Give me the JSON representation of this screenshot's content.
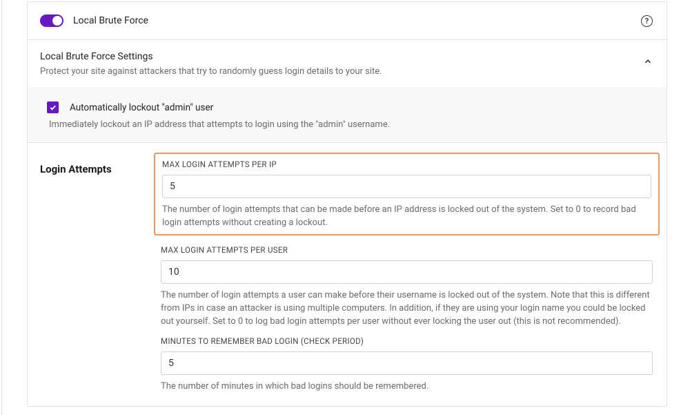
{
  "header": {
    "feature_title": "Local Brute Force",
    "help_char": "?"
  },
  "settings": {
    "title": "Local Brute Force Settings",
    "description": "Protect your site against attackers that try to randomly guess login details to your site."
  },
  "admin_lockout": {
    "label": "Automatically lockout \"admin\" user",
    "desc": "Immediately lockout an IP address that attempts to login using the \"admin\" username."
  },
  "login_attempts": {
    "section_title": "Login Attempts",
    "per_ip": {
      "label": "MAX LOGIN ATTEMPTS PER IP",
      "value": "5",
      "help": "The number of login attempts that can be made before an IP address is locked out of the system. Set to 0 to record bad login attempts without creating a lockout."
    },
    "per_user": {
      "label": "MAX LOGIN ATTEMPTS PER USER",
      "value": "10",
      "help": "The number of login attempts a user can make before their username is locked out of the system. Note that this is different from IPs in case an attacker is using multiple computers. In addition, if they are using your login name you could be locked out yourself. Set to 0 to log bad login attempts per user without ever locking the user out (this is not recommended)."
    },
    "minutes": {
      "label": "MINUTES TO REMEMBER BAD LOGIN (CHECK PERIOD)",
      "value": "5",
      "help": "The number of minutes in which bad logins should be remembered."
    }
  }
}
